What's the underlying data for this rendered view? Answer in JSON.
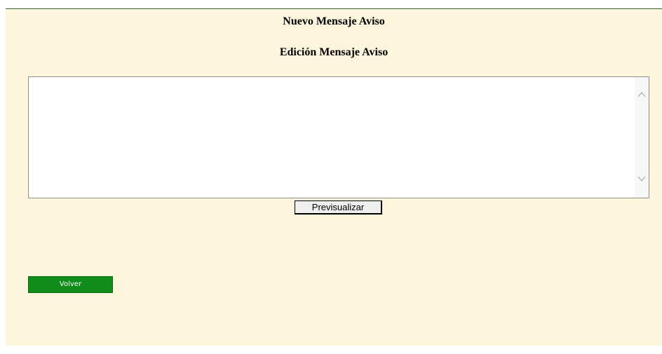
{
  "page": {
    "title": "Nuevo Mensaje Aviso",
    "subtitle": "Edición Mensaje Aviso"
  },
  "editor": {
    "value": "",
    "scrollbar_up_icon": "chevron-up-icon",
    "scrollbar_down_icon": "chevron-down-icon"
  },
  "actions": {
    "preview_label": "Previsualizar",
    "back_label": "Volver"
  },
  "colors": {
    "background": "#fdf5dc",
    "back_button": "#0f8c1a",
    "top_border": "#2e6b2e"
  }
}
